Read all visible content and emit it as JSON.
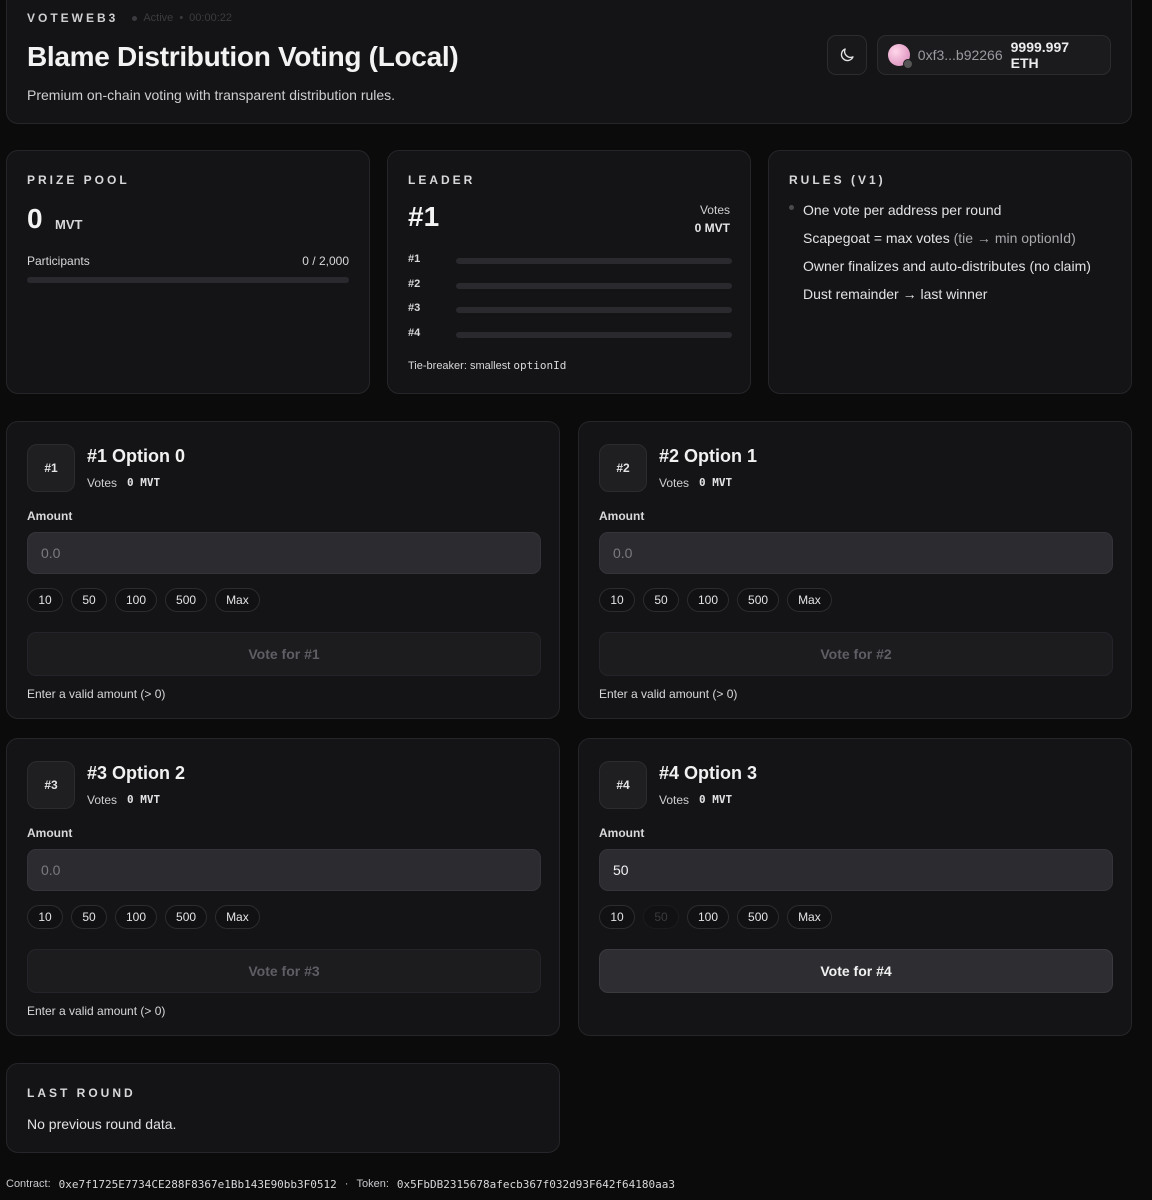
{
  "header": {
    "brand": "VOTEWEB3",
    "status": "Active",
    "timer": "00:00:22",
    "title": "Blame Distribution Voting (Local)",
    "subtitle": "Premium on-chain voting with transparent distribution rules.",
    "wallet_address": "0xf3...b92266",
    "wallet_balance": "9999.997 ETH"
  },
  "prize_pool": {
    "label": "PRIZE POOL",
    "amount": "0",
    "unit": "MVT",
    "participants_label": "Participants",
    "participants_value": "0 / 2,000",
    "participants_fraction": 0
  },
  "leader": {
    "label": "LEADER",
    "rank": "#1",
    "votes_label": "Votes",
    "votes_value": "0 MVT",
    "rows": [
      {
        "label": "#1",
        "fraction": 0
      },
      {
        "label": "#2",
        "fraction": 0
      },
      {
        "label": "#3",
        "fraction": 0
      },
      {
        "label": "#4",
        "fraction": 0
      }
    ],
    "tiebreak_prefix": "Tie-breaker: smallest ",
    "tiebreak_code": "optionId"
  },
  "rules": {
    "label": "RULES (V1)",
    "items": [
      {
        "text": "One vote per address per round",
        "muted": ""
      },
      {
        "text": "Scapegoat = max votes ",
        "muted": "(tie → min optionId)"
      },
      {
        "text": "Owner finalizes and auto-distributes (no claim)",
        "muted": ""
      },
      {
        "text": "Dust remainder → last winner",
        "muted": ""
      }
    ]
  },
  "options": [
    {
      "badge": "#1",
      "title": "#1 Option 0",
      "votes_label": "Votes",
      "votes_value": "0 MVT",
      "amount_label": "Amount",
      "placeholder": "0.0",
      "value": "",
      "chips": [
        "10",
        "50",
        "100",
        "500",
        "Max"
      ],
      "vote_label": "Vote for #1",
      "hint": "Enter a valid amount (> 0)"
    },
    {
      "badge": "#2",
      "title": "#2 Option 1",
      "votes_label": "Votes",
      "votes_value": "0 MVT",
      "amount_label": "Amount",
      "placeholder": "0.0",
      "value": "",
      "chips": [
        "10",
        "50",
        "100",
        "500",
        "Max"
      ],
      "vote_label": "Vote for #2",
      "hint": "Enter a valid amount (> 0)"
    },
    {
      "badge": "#3",
      "title": "#3 Option 2",
      "votes_label": "Votes",
      "votes_value": "0 MVT",
      "amount_label": "Amount",
      "placeholder": "0.0",
      "value": "",
      "chips": [
        "10",
        "50",
        "100",
        "500",
        "Max"
      ],
      "vote_label": "Vote for #3",
      "hint": "Enter a valid amount (> 0)"
    },
    {
      "badge": "#4",
      "title": "#4 Option 3",
      "votes_label": "Votes",
      "votes_value": "0 MVT",
      "amount_label": "Amount",
      "placeholder": "0.0",
      "value": "50",
      "chips": [
        "10",
        "50",
        "100",
        "500",
        "Max"
      ],
      "vote_label": "Vote for #4",
      "hint": ""
    }
  ],
  "last_round": {
    "label": "LAST ROUND",
    "text": "No previous round data."
  },
  "footer": {
    "contract_label": "Contract:",
    "contract": "0xe7f1725E7734CE288F8367e1Bb143E90bb3F0512",
    "sep": "·",
    "token_label": "Token:",
    "token": "0x5FbDB2315678afecb367f032d93F642f64180aa3"
  },
  "icons": {
    "theme": "moon-icon",
    "avatar": "wallet-avatar"
  }
}
